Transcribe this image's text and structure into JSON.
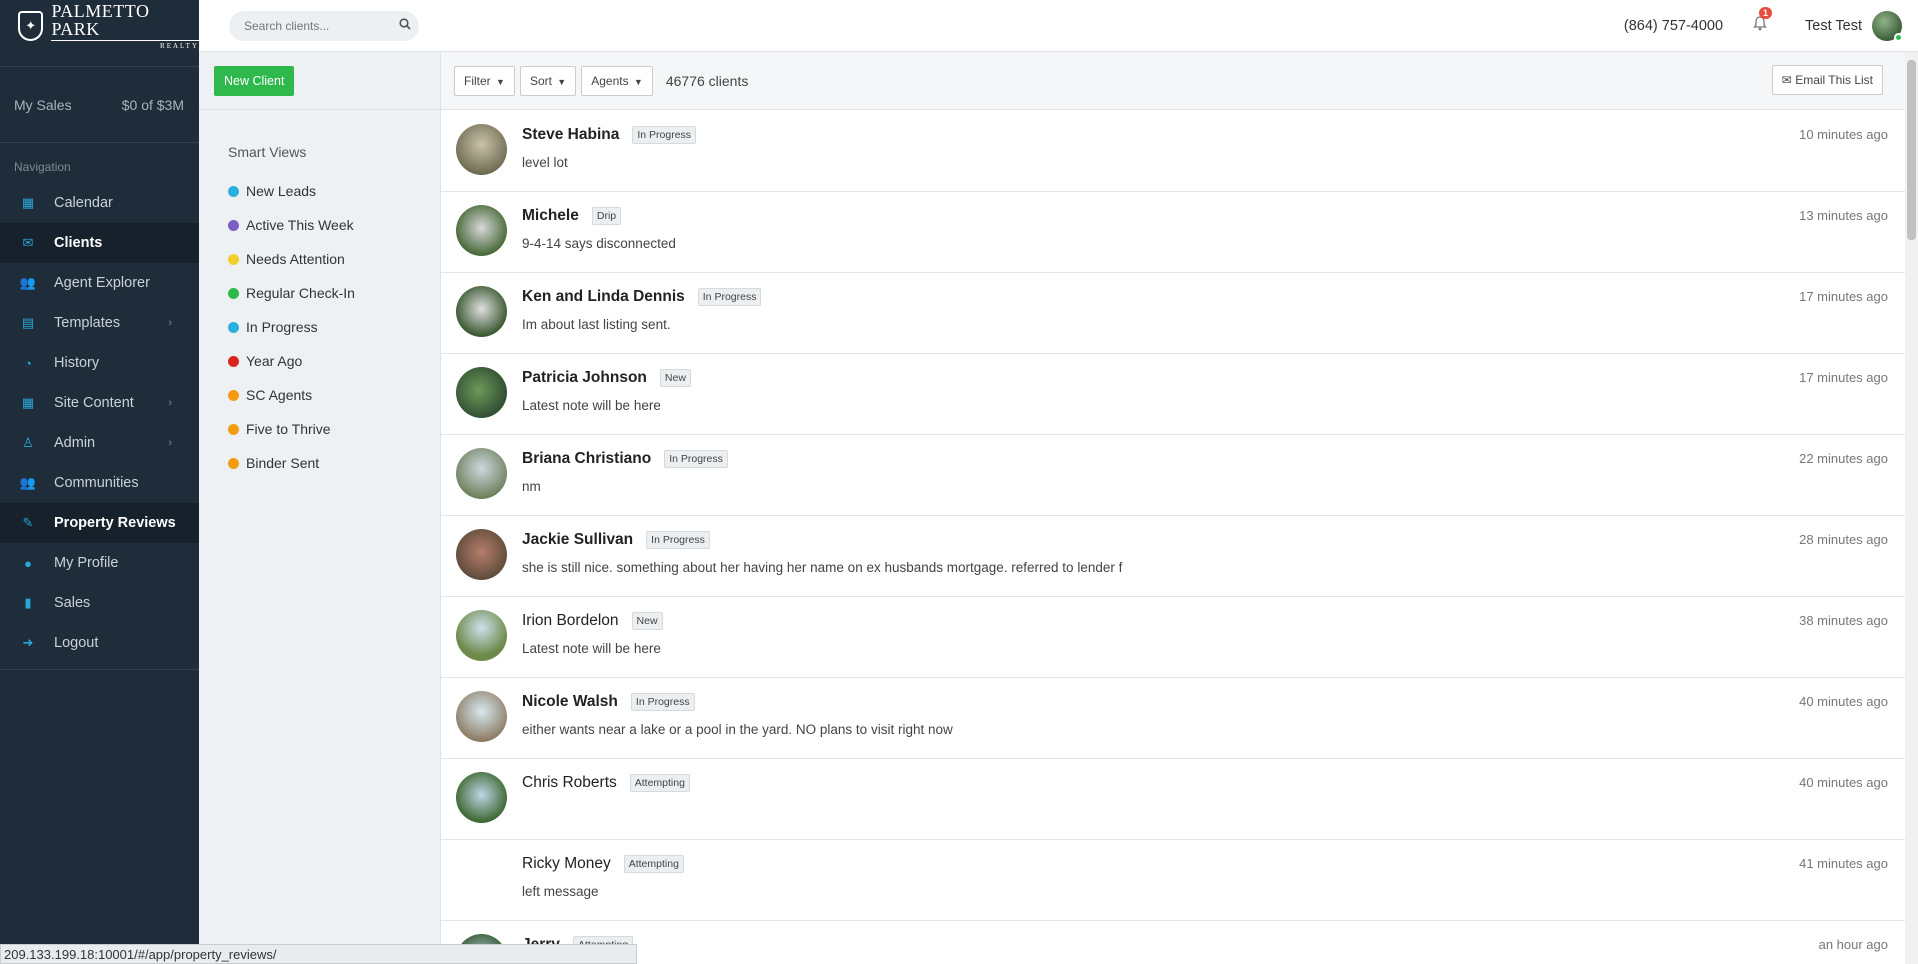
{
  "brand": {
    "line1": "PALMETTO PARK",
    "line2": "REALTY"
  },
  "sidebar": {
    "sales_label": "My Sales",
    "sales_value": "$0 of $3M",
    "nav_heading": "Navigation",
    "items": [
      {
        "label": "Calendar",
        "icon": "calendar-icon"
      },
      {
        "label": "Clients",
        "icon": "envelope-icon"
      },
      {
        "label": "Agent Explorer",
        "icon": "users-icon"
      },
      {
        "label": "Templates",
        "icon": "file-icon"
      },
      {
        "label": "History",
        "icon": "rss-icon"
      },
      {
        "label": "Site Content",
        "icon": "grid-icon"
      },
      {
        "label": "Admin",
        "icon": "user-outline-icon"
      },
      {
        "label": "Communities",
        "icon": "users-icon"
      },
      {
        "label": "Property Reviews",
        "icon": "edit-icon"
      },
      {
        "label": "My Profile",
        "icon": "user-icon"
      },
      {
        "label": "Sales",
        "icon": "bar-chart-icon"
      },
      {
        "label": "Logout",
        "icon": "sign-out-icon"
      }
    ]
  },
  "topbar": {
    "search_placeholder": "Search clients...",
    "phone": "(864) 757-4000",
    "notification_count": "1",
    "user_name": "Test Test"
  },
  "smart_views": {
    "new_client_label": "New Client",
    "title": "Smart Views",
    "items": [
      {
        "label": "New Leads",
        "color": "#2ab0e0"
      },
      {
        "label": "Active This Week",
        "color": "#7a5fc4"
      },
      {
        "label": "Needs Attention",
        "color": "#f2cf2a"
      },
      {
        "label": "Regular Check-In",
        "color": "#2fb94c"
      },
      {
        "label": "In Progress",
        "color": "#2ab0e0"
      },
      {
        "label": "Year Ago",
        "color": "#d9261c"
      },
      {
        "label": "SC Agents",
        "color": "#f39c12"
      },
      {
        "label": "Five to Thrive",
        "color": "#f39c12"
      },
      {
        "label": "Binder Sent",
        "color": "#f39c12"
      }
    ]
  },
  "toolbar": {
    "filter_label": "Filter",
    "sort_label": "Sort",
    "agents_label": "Agents",
    "count_label": "46776 clients",
    "email_label": "Email This List"
  },
  "clients": [
    {
      "name": "Steve Habina",
      "status": "In Progress",
      "note": "level lot",
      "time": "10 minutes ago",
      "bold": true
    },
    {
      "name": "Michele",
      "status": "Drip",
      "note": "9-4-14 says disconnected",
      "time": "13 minutes ago",
      "bold": true
    },
    {
      "name": "Ken and Linda Dennis",
      "status": "In Progress",
      "note": "Im about last listing sent.",
      "time": "17 minutes ago",
      "bold": true
    },
    {
      "name": "Patricia Johnson",
      "status": "New",
      "note": "Latest note will be here",
      "time": "17 minutes ago",
      "bold": true
    },
    {
      "name": "Briana Christiano",
      "status": "In Progress",
      "note": "nm",
      "time": "22 minutes ago",
      "bold": true
    },
    {
      "name": "Jackie Sullivan",
      "status": "In Progress",
      "note": "she is still nice. something about her having her name on ex husbands mortgage. referred to lender f",
      "time": "28 minutes ago",
      "bold": true
    },
    {
      "name": "Irion Bordelon",
      "status": "New",
      "note": "Latest note will be here",
      "time": "38 minutes ago",
      "bold": false
    },
    {
      "name": "Nicole Walsh",
      "status": "In Progress",
      "note": "either wants near a lake or a pool in the yard. NO plans to visit right now",
      "time": "40 minutes ago",
      "bold": true
    },
    {
      "name": "Chris Roberts",
      "status": "Attempting",
      "note": "",
      "time": "40 minutes ago",
      "bold": false
    },
    {
      "name": "Ricky Money",
      "status": "Attempting",
      "note": "left message",
      "time": "41 minutes ago",
      "bold": false
    },
    {
      "name": "Jerry",
      "status": "Attempting",
      "note": "",
      "time": "an hour ago",
      "bold": true
    }
  ],
  "status_url": "209.133.199.18:10001/#/app/property_reviews/"
}
